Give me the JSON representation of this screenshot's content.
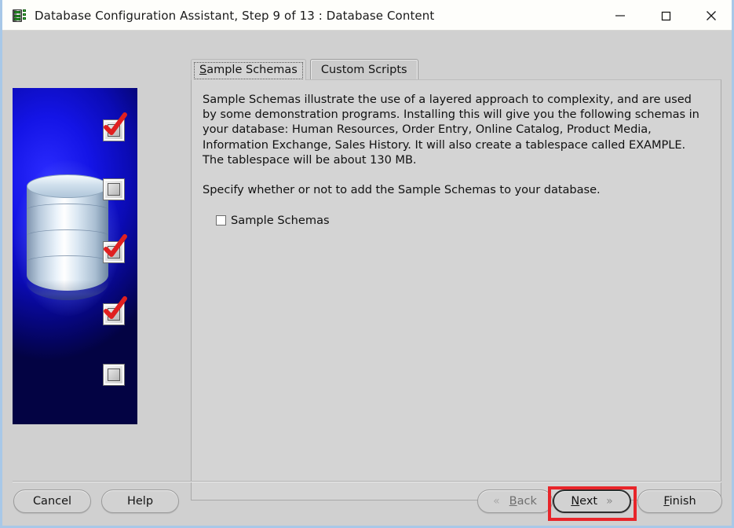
{
  "window": {
    "title": "Database Configuration Assistant, Step 9 of 13 : Database Content",
    "app_icon": "database-server-icon",
    "controls": {
      "minimize": "minimize-icon",
      "maximize": "maximize-icon",
      "close": "close-icon"
    }
  },
  "tabs": [
    {
      "label": "Sample Schemas",
      "mnemonic": "S",
      "rest": "ample Schemas",
      "selected": true
    },
    {
      "label": "Custom Scripts",
      "selected": false
    }
  ],
  "panel": {
    "paragraph1": "Sample Schemas illustrate the use of a layered approach to complexity, and are used by some demonstration programs. Installing this will give you the following schemas in your database: Human Resources, Order Entry, Online Catalog, Product Media, Information Exchange, Sales History. It will also create a tablespace called EXAMPLE. The tablespace will be about 130 MB.",
    "paragraph2": "Specify whether or not to add the Sample Schemas to your database.",
    "checkbox": {
      "label": "Sample Schemas",
      "checked": false
    }
  },
  "sidebar": {
    "graphic": "database-cylinder-with-checkboxes",
    "background_color": "#0b0bb4",
    "checkbox_icons": [
      {
        "checked": true
      },
      {
        "checked": false
      },
      {
        "checked": true
      },
      {
        "checked": true
      },
      {
        "checked": false
      }
    ],
    "check_color": "#e02020"
  },
  "footer": {
    "cancel": {
      "label": "Cancel"
    },
    "help": {
      "label": "Help"
    },
    "back": {
      "mnemonic": "B",
      "rest": "ack",
      "label": "Back",
      "enabled": false,
      "chevron": "«"
    },
    "next": {
      "mnemonic": "N",
      "rest": "ext",
      "label": "Next",
      "enabled": true,
      "focused": true,
      "chevron": "»"
    },
    "finish": {
      "mnemonic": "F",
      "rest": "inish",
      "label": "Finish"
    }
  },
  "annotation": {
    "highlight_color": "#e8252a",
    "target": "next-button"
  }
}
